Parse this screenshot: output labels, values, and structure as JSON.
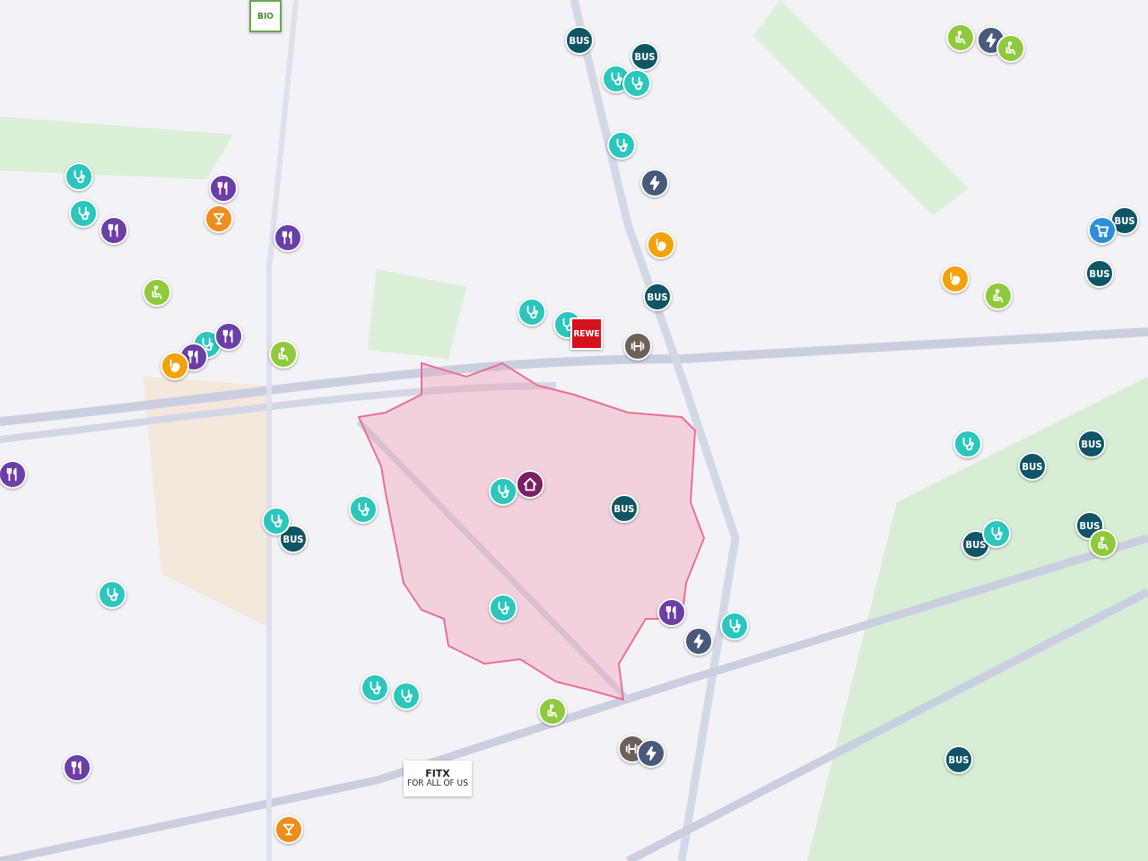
{
  "area": {
    "kind": "highlight"
  },
  "markers": [
    {
      "kind": "bus",
      "label": "BUS"
    },
    {
      "kind": "bus",
      "label": "BUS"
    },
    {
      "kind": "bus",
      "label": "BUS"
    },
    {
      "kind": "bus",
      "label": "BUS"
    },
    {
      "kind": "bus",
      "label": "BUS"
    },
    {
      "kind": "bus",
      "label": "BUS"
    },
    {
      "kind": "bus",
      "label": "BUS"
    },
    {
      "kind": "bus",
      "label": "BUS"
    },
    {
      "kind": "bus",
      "label": "BUS"
    },
    {
      "kind": "bus",
      "label": "BUS"
    },
    {
      "kind": "bus",
      "label": "BUS"
    },
    {
      "kind": "bus",
      "label": "BUS"
    },
    {
      "kind": "medical"
    },
    {
      "kind": "medical"
    },
    {
      "kind": "medical"
    },
    {
      "kind": "medical"
    },
    {
      "kind": "medical"
    },
    {
      "kind": "medical"
    },
    {
      "kind": "medical"
    },
    {
      "kind": "medical"
    },
    {
      "kind": "medical"
    },
    {
      "kind": "medical"
    },
    {
      "kind": "medical"
    },
    {
      "kind": "medical"
    },
    {
      "kind": "medical"
    },
    {
      "kind": "medical"
    },
    {
      "kind": "medical"
    },
    {
      "kind": "medical"
    },
    {
      "kind": "medical"
    },
    {
      "kind": "medical"
    },
    {
      "kind": "restaurant"
    },
    {
      "kind": "restaurant"
    },
    {
      "kind": "restaurant"
    },
    {
      "kind": "restaurant"
    },
    {
      "kind": "restaurant"
    },
    {
      "kind": "restaurant"
    },
    {
      "kind": "restaurant"
    },
    {
      "kind": "restaurant"
    },
    {
      "kind": "bar"
    },
    {
      "kind": "bar"
    },
    {
      "kind": "gym"
    },
    {
      "kind": "gym"
    },
    {
      "kind": "charging"
    },
    {
      "kind": "charging"
    },
    {
      "kind": "charging"
    },
    {
      "kind": "charging"
    },
    {
      "kind": "senior"
    },
    {
      "kind": "senior"
    },
    {
      "kind": "senior"
    },
    {
      "kind": "senior"
    },
    {
      "kind": "senior"
    },
    {
      "kind": "senior"
    },
    {
      "kind": "senior"
    },
    {
      "kind": "grocery"
    },
    {
      "kind": "grocery"
    },
    {
      "kind": "grocery"
    },
    {
      "kind": "cart"
    },
    {
      "kind": "home"
    }
  ],
  "logos": [
    {
      "kind": "rewe",
      "label": "REWE"
    },
    {
      "kind": "bio",
      "label": "BIO"
    },
    {
      "kind": "fitx",
      "label": "FITX",
      "tagline": "FOR ALL OF US"
    }
  ]
}
